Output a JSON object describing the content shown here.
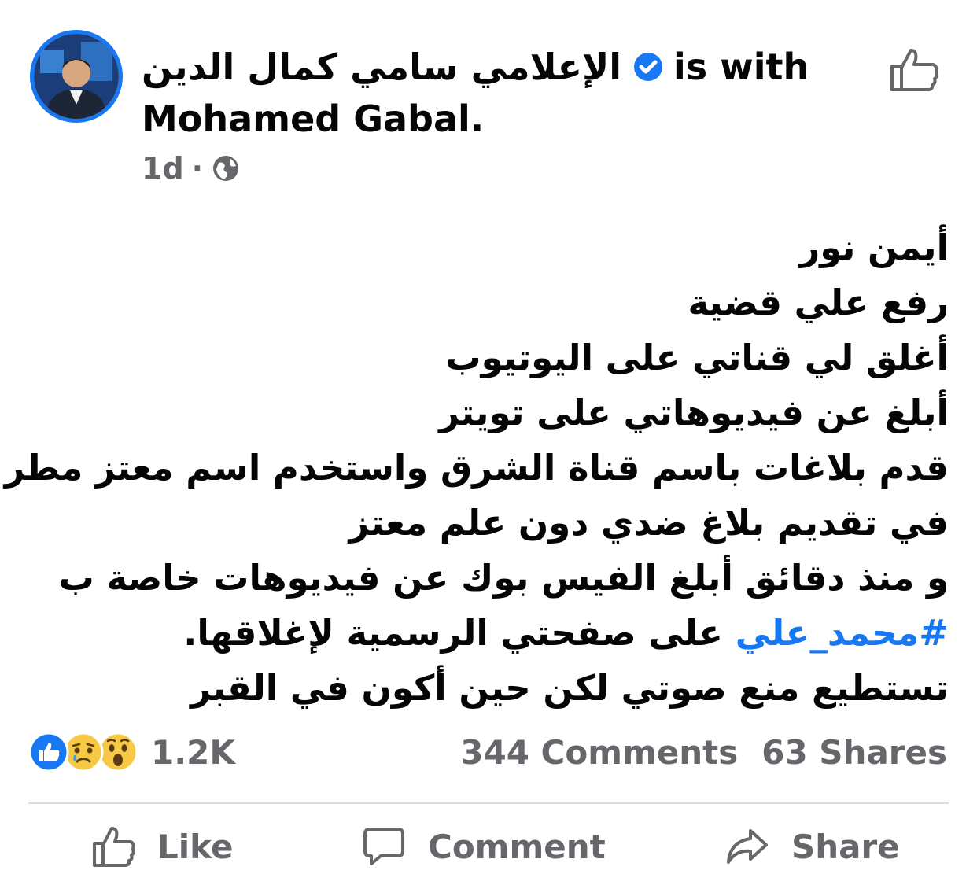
{
  "post": {
    "author_name": "الإعلامي سامي كمال الدين",
    "with_text": "is with",
    "tagged_name": "Mohamed Gabal.",
    "time": "1d",
    "separator": "·",
    "privacy_icon": "globe-icon",
    "verified_icon": "verified-badge-icon",
    "lines": [
      "أيمن نور",
      "رفع علي قضية",
      "أغلق لي قناتي على اليوتيوب",
      "أبلغ عن فيديوهاتي على تويتر",
      "قدم بلاغات باسم قناة الشرق واستخدم اسم معتز مطر",
      "في تقديم بلاغ ضدي دون علم معتز",
      "و منذ دقائق أبلغ الفيس بوك عن فيديوهات خاصة ب"
    ],
    "hashtag": "#محمد_علي",
    "line_after_hashtag": " على صفحتي الرسمية لإغلاقها.",
    "last_line": "تستطيع منع صوتي لكن حين أكون في القبر"
  },
  "reactions": {
    "icons": [
      "like-reaction-icon",
      "sad-reaction-icon",
      "wow-reaction-icon"
    ],
    "count": "1.2K"
  },
  "stats": {
    "comments": "344 Comments",
    "shares": "63 Shares"
  },
  "actions": {
    "like": "Like",
    "comment": "Comment",
    "share": "Share"
  },
  "colors": {
    "accent": "#1877f2",
    "secondary_text": "#65676b",
    "divider": "#dadde1"
  }
}
